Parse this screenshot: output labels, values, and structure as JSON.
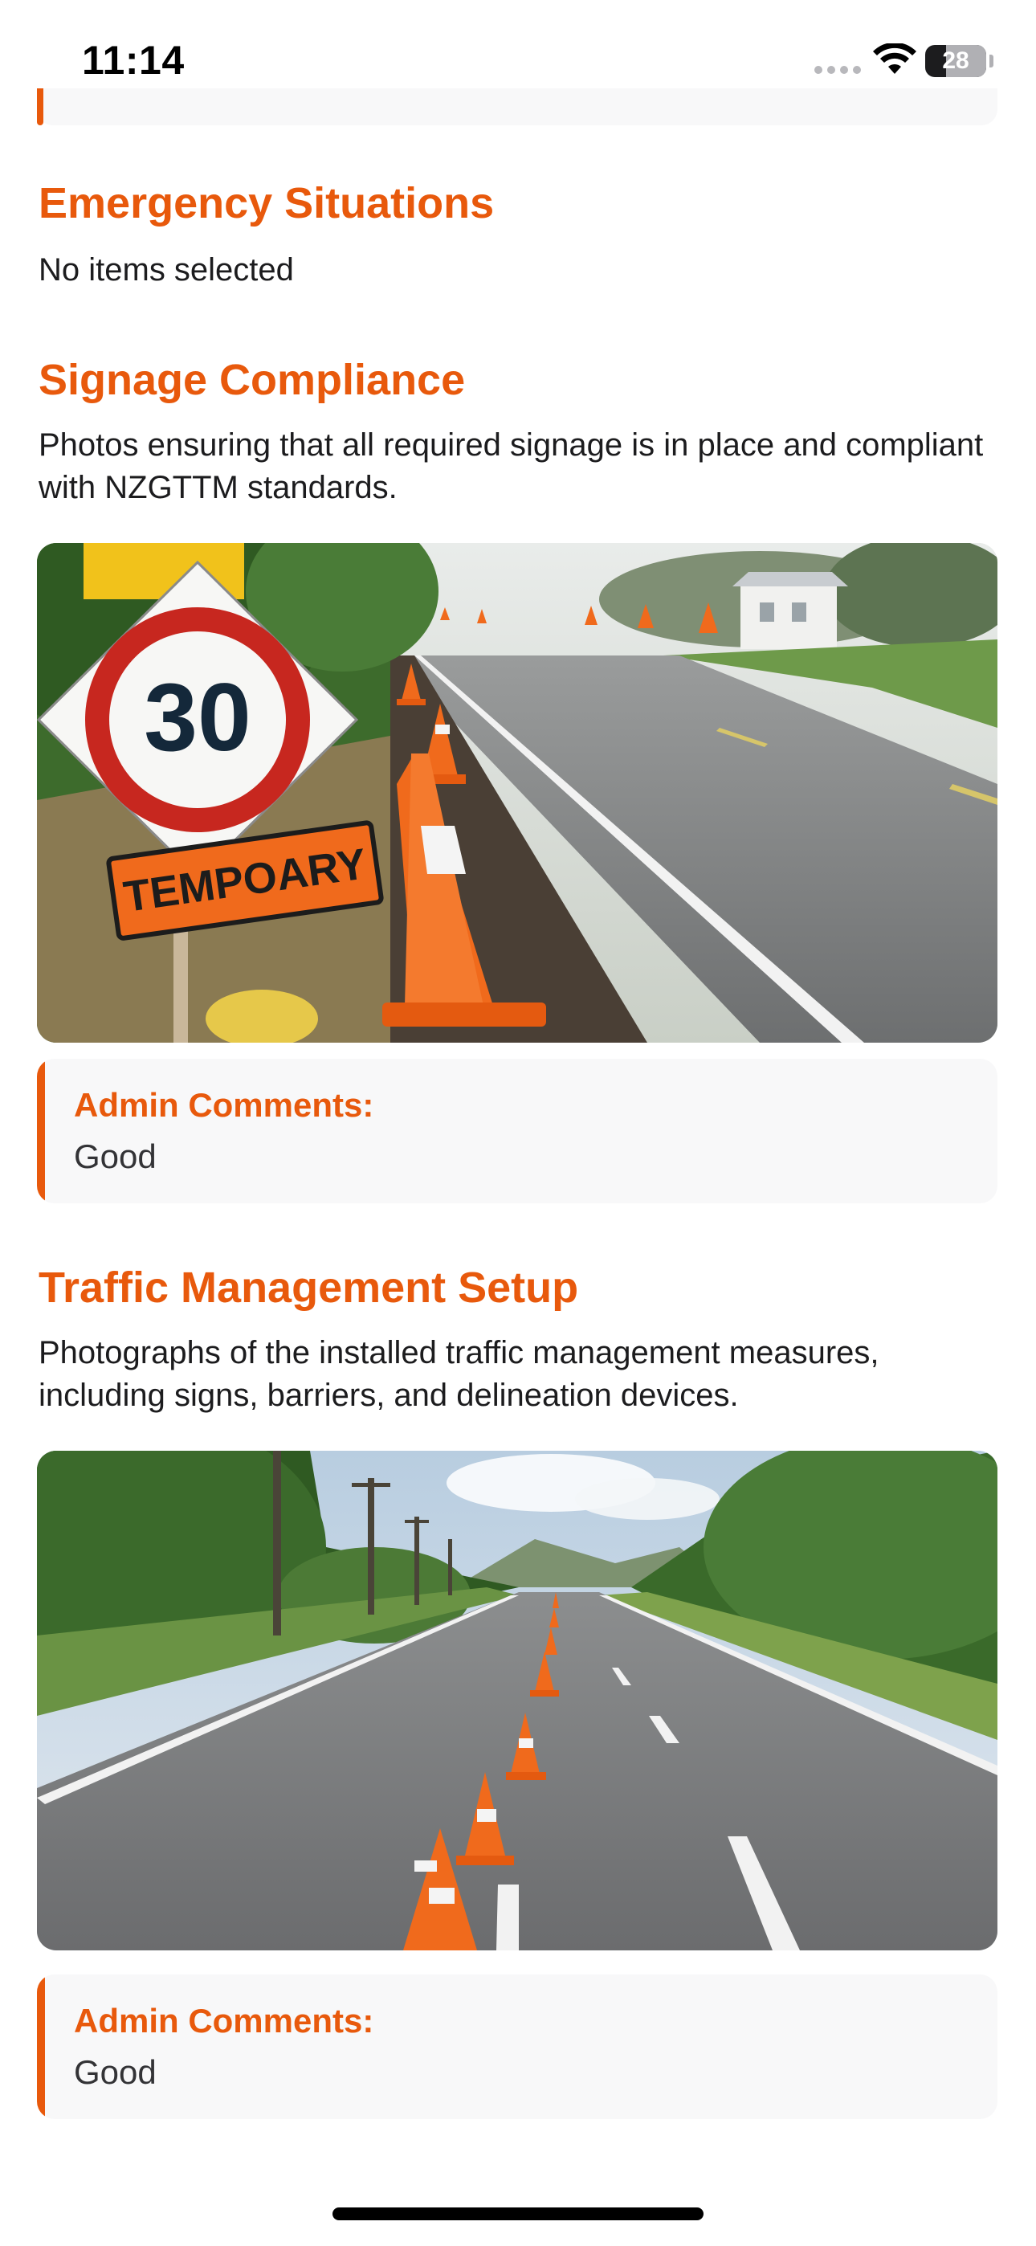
{
  "status_bar": {
    "time": "11:14",
    "battery": "28",
    "icons": [
      "signal-dots-icon",
      "wifi-icon",
      "battery-icon"
    ]
  },
  "sections": [
    {
      "title": "Emergency Situations",
      "body": "No items selected"
    },
    {
      "title": "Signage Compliance",
      "body": "Photos ensuring that all required signage is in place and compliant with NZGTTM standards.",
      "photo": {
        "sign_speed": "30",
        "sign_text": "TEMPOARY"
      },
      "comment_label": "Admin Comments:",
      "comment": "Good"
    },
    {
      "title": "Traffic Management Setup",
      "body": "Photographs of the installed traffic management measures, including signs, barriers, and delineation devices.",
      "comment_label": "Admin Comments:",
      "comment": "Good"
    }
  ],
  "colors": {
    "accent": "#e8590c",
    "card_background": "#f8f8f9",
    "text": "#1c1c1e"
  }
}
